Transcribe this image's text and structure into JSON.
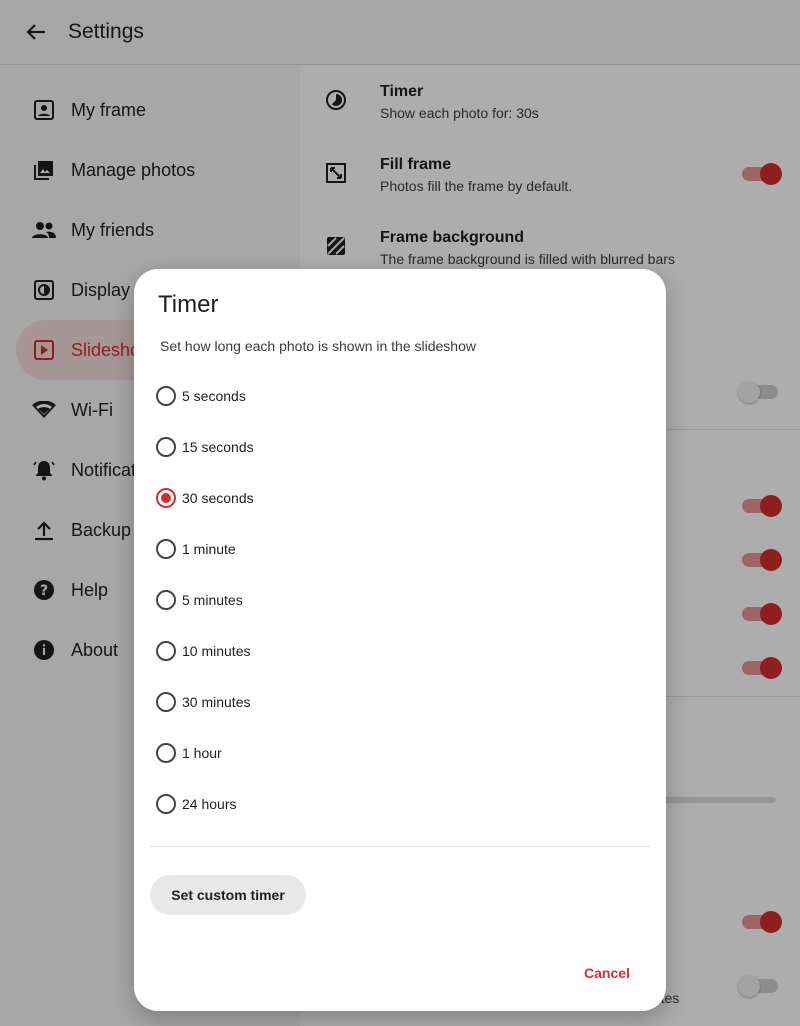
{
  "appbar": {
    "title": "Settings",
    "back_icon": "arrow-back-icon"
  },
  "sidebar": {
    "items": [
      {
        "label": "My frame",
        "icon": "account-box-icon",
        "active": false
      },
      {
        "label": "Manage photos",
        "icon": "photo-library-icon",
        "active": false
      },
      {
        "label": "My friends",
        "icon": "people-icon",
        "active": false
      },
      {
        "label": "Display",
        "icon": "display-icon",
        "active": false
      },
      {
        "label": "Slideshow",
        "icon": "slideshow-icon",
        "active": true
      },
      {
        "label": "Wi-Fi",
        "icon": "wifi-icon",
        "active": false
      },
      {
        "label": "Notifications",
        "icon": "notifications-icon",
        "active": false
      },
      {
        "label": "Backup",
        "icon": "upload-icon",
        "active": false
      },
      {
        "label": "Help",
        "icon": "help-icon",
        "active": false
      },
      {
        "label": "About",
        "icon": "info-icon",
        "active": false
      }
    ]
  },
  "content": {
    "timer": {
      "title": "Timer",
      "subtitle": "Show each photo for: 30s",
      "icon": "timer-icon"
    },
    "fill_frame": {
      "title": "Fill frame",
      "subtitle": "Photos fill the frame by default.",
      "icon": "fit-screen-icon",
      "enabled": true
    },
    "frame_background": {
      "title": "Frame background",
      "subtitle": "The frame background is filled with blurred bars",
      "icon": "texture-icon"
    },
    "partial_text": "nutes"
  },
  "dialog": {
    "title": "Timer",
    "subtitle": "Set how long each photo is shown in the slideshow",
    "options": [
      {
        "label": "5 seconds",
        "selected": false
      },
      {
        "label": "15 seconds",
        "selected": false
      },
      {
        "label": "30 seconds",
        "selected": true
      },
      {
        "label": "1 minute",
        "selected": false
      },
      {
        "label": "5 minutes",
        "selected": false
      },
      {
        "label": "10 minutes",
        "selected": false
      },
      {
        "label": "30 minutes",
        "selected": false
      },
      {
        "label": "1 hour",
        "selected": false
      },
      {
        "label": "24 hours",
        "selected": false
      }
    ],
    "custom_button": "Set custom timer",
    "cancel_button": "Cancel"
  },
  "colors": {
    "accent": "#d32f2f",
    "accent_light": "#f7dede"
  }
}
